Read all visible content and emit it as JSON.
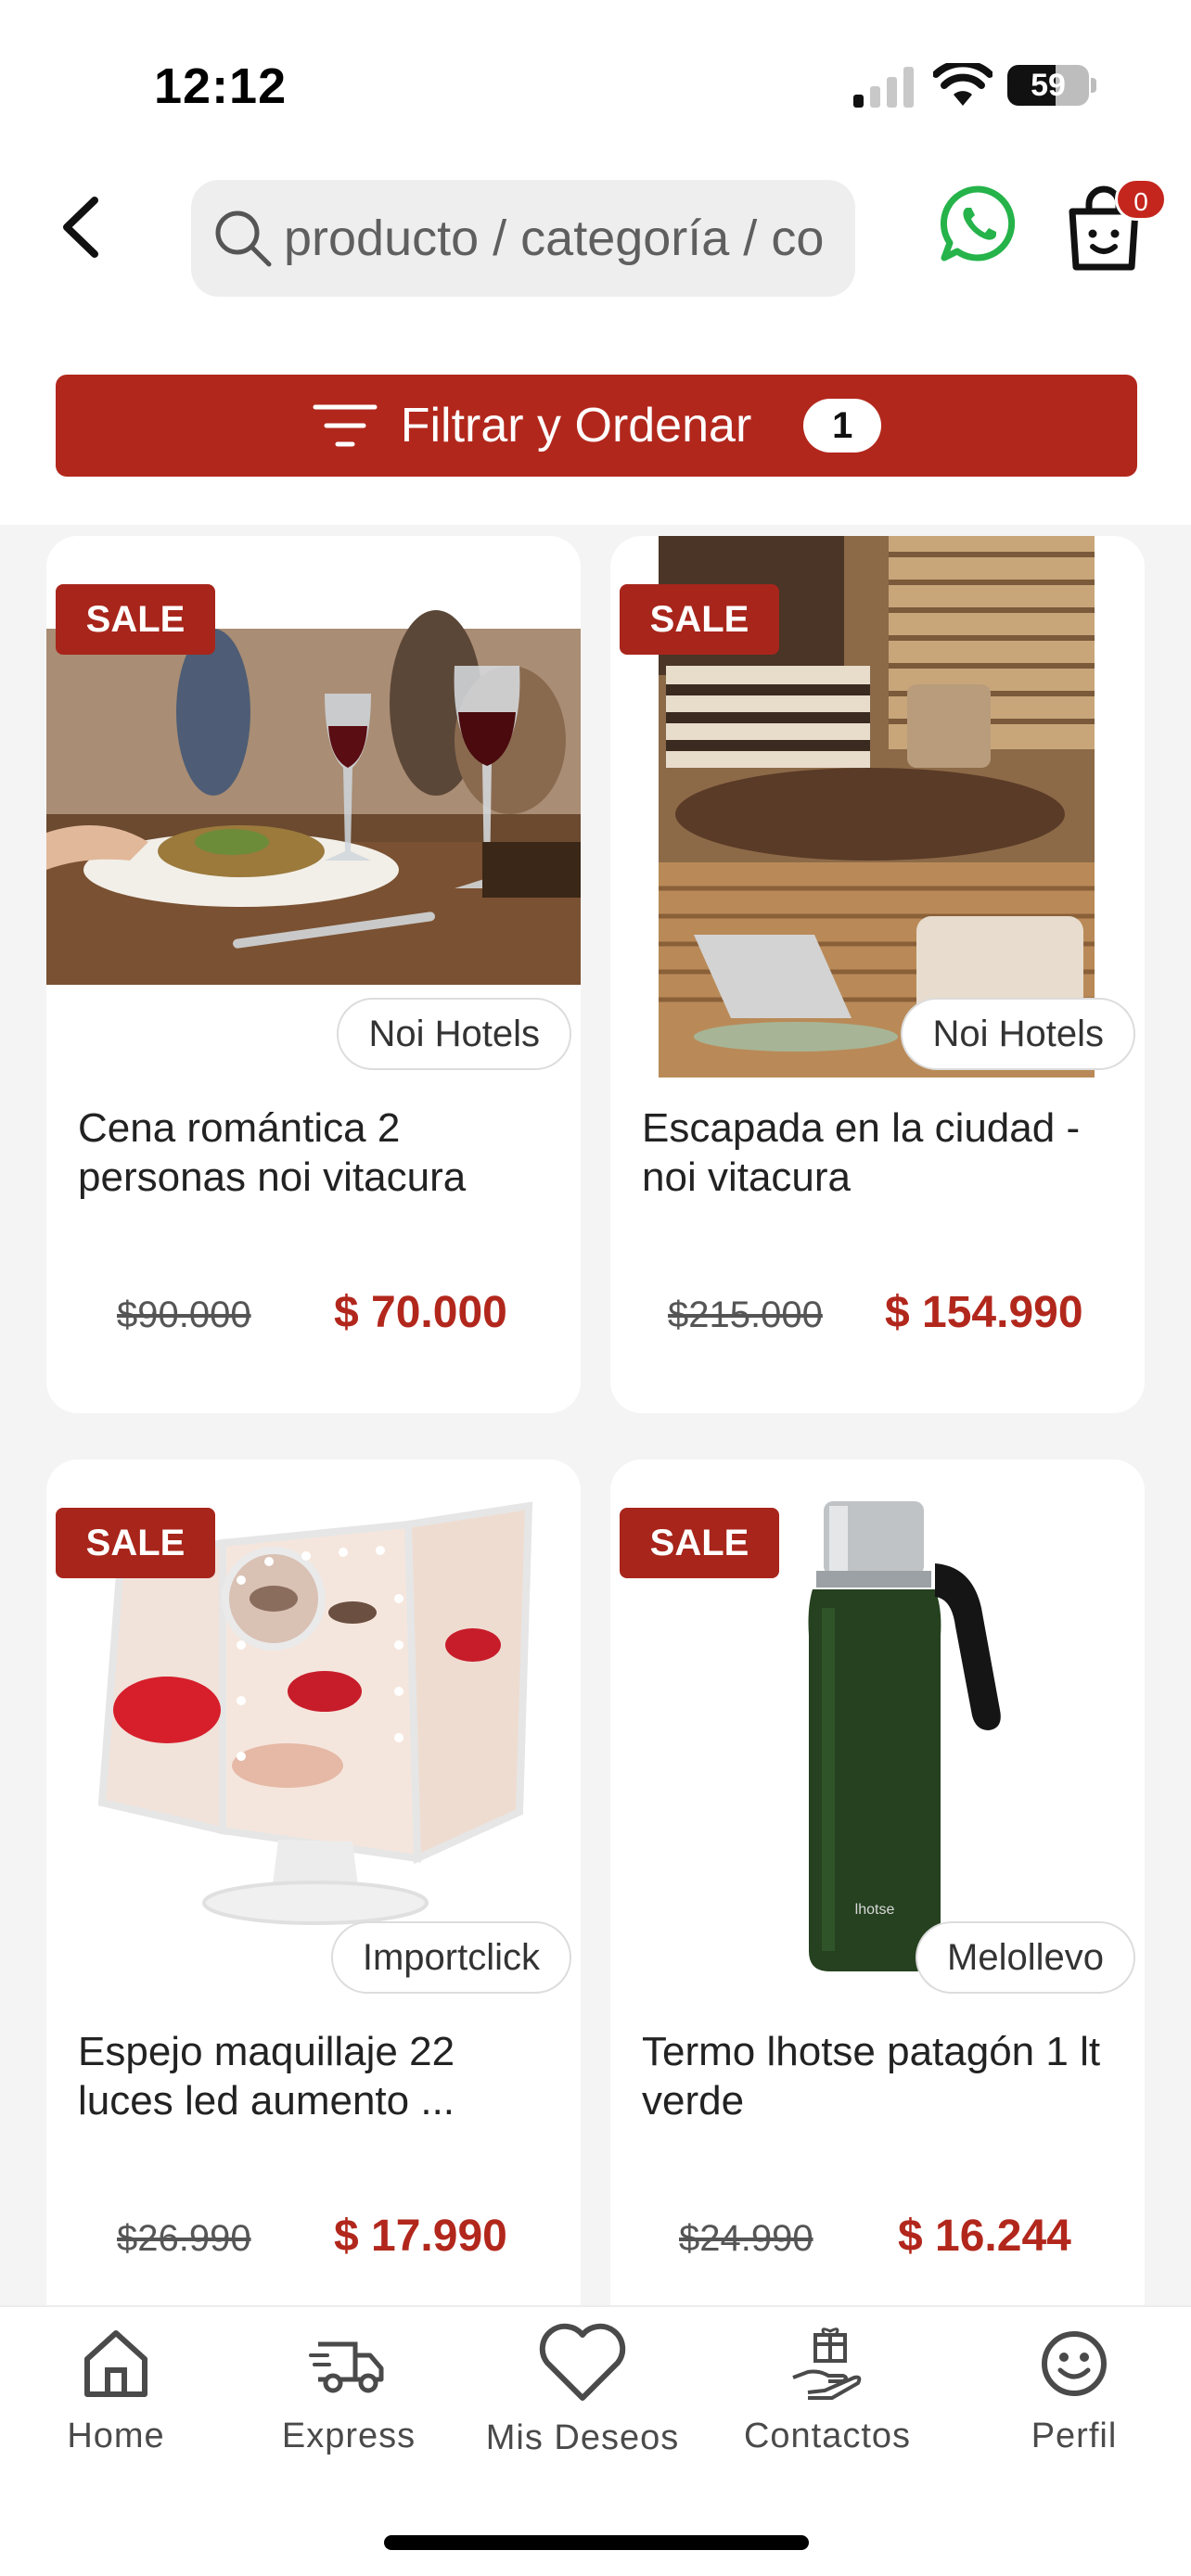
{
  "status_bar": {
    "time": "12:12",
    "battery": "59",
    "battery_level": 0.59
  },
  "header": {
    "search_placeholder": "producto / categoría / co",
    "cart_count": "0",
    "back_icon": "chevron-left-icon",
    "whatsapp_icon": "whatsapp-icon",
    "cart_icon": "shopping-bag-icon"
  },
  "filter": {
    "label": "Filtrar y Ordenar",
    "count": "1"
  },
  "colors": {
    "accent": "#b2271c",
    "whatsapp": "#25b34a",
    "badge": "#c4261d"
  },
  "products": [
    {
      "badge": "SALE",
      "brand": "Noi Hotels",
      "name": "Cena romántica 2 personas noi vitacura",
      "old_price": "$90.000",
      "price": "$ 70.000"
    },
    {
      "badge": "SALE",
      "brand": "Noi Hotels",
      "name": "Escapada en la ciudad - noi vitacura",
      "old_price": "$215.000",
      "price": "$ 154.990"
    },
    {
      "badge": "SALE",
      "brand": "Importclick",
      "name": "Espejo maquillaje 22 luces led aumento ...",
      "old_price": "$26.990",
      "price": "$ 17.990"
    },
    {
      "badge": "SALE",
      "brand": "Melollevo",
      "name": "Termo lhotse patagón 1 lt verde",
      "old_price": "$24.990",
      "price": "$ 16.244"
    }
  ],
  "bottom_nav": [
    {
      "label": "Home",
      "icon": "home-icon"
    },
    {
      "label": "Express",
      "icon": "truck-icon"
    },
    {
      "label": "Mis Deseos",
      "icon": "heart-icon"
    },
    {
      "label": "Contactos",
      "icon": "gift-hand-icon"
    },
    {
      "label": "Perfil",
      "icon": "smiley-icon"
    }
  ]
}
